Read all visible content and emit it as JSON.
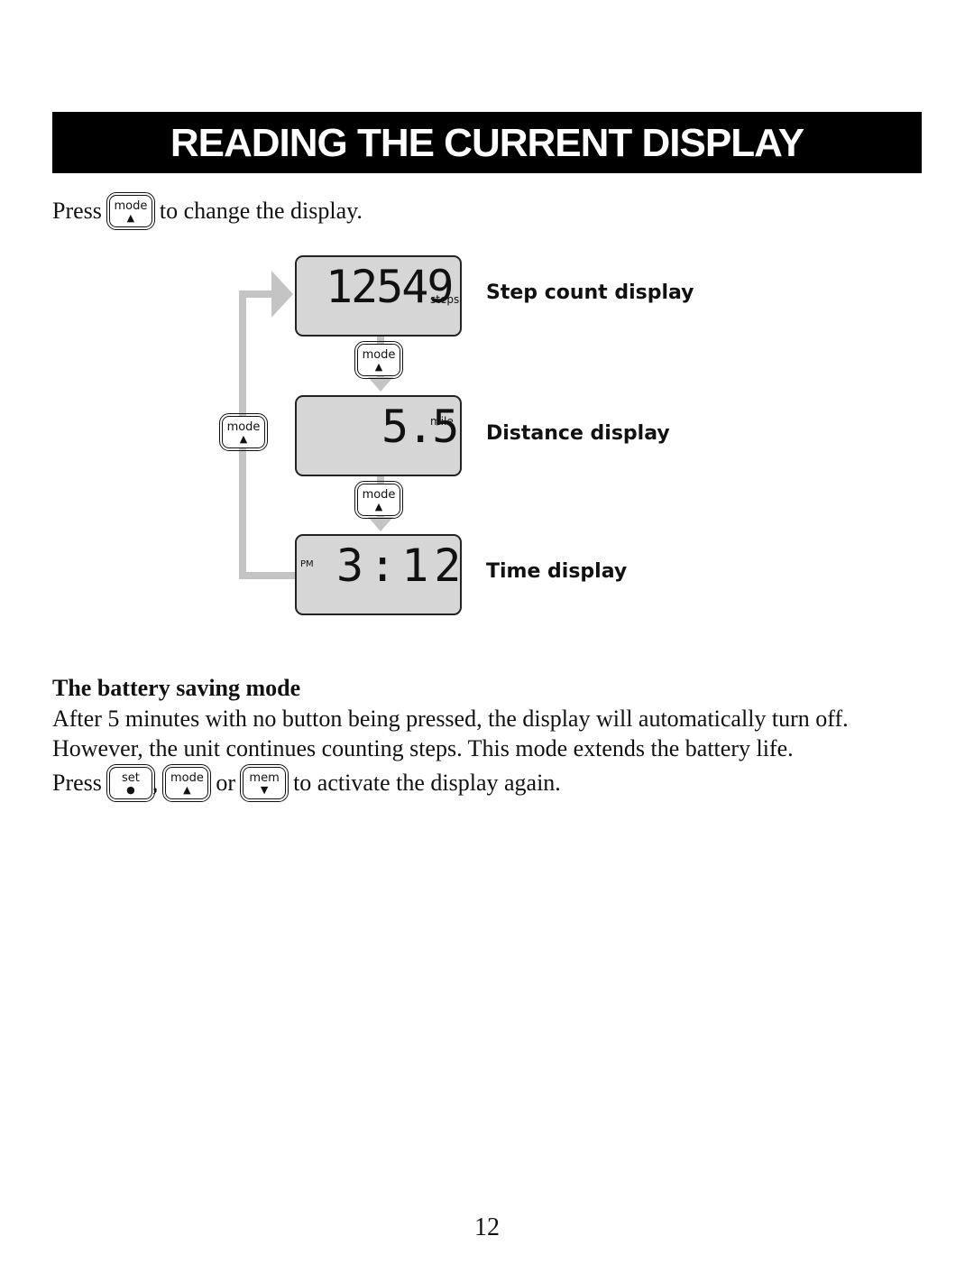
{
  "title": "READING THE CURRENT DISPLAY",
  "intro": {
    "before": "Press",
    "after": "to change the display."
  },
  "keys": {
    "mode": {
      "label": "mode",
      "glyph": "▲"
    },
    "set": {
      "label": "set",
      "glyph": "●"
    },
    "mem": {
      "label": "mem",
      "glyph": "▼"
    }
  },
  "displays": [
    {
      "value": "12549",
      "unit": "steps",
      "label": "Step count display"
    },
    {
      "value": "5.5",
      "unit": "mile",
      "label": "Distance display"
    },
    {
      "value": "3:12",
      "unit": "PM",
      "label": "Time display"
    }
  ],
  "battery": {
    "heading": "The battery saving mode",
    "line1": "After 5 minutes with no button being pressed, the display will automatically turn off.",
    "line2": "However, the unit continues counting steps. This mode extends the battery life.",
    "press": "Press",
    "comma": ",",
    "or": "or",
    "after": "to activate the display again."
  },
  "page_number": "12",
  "colors": {
    "connector": "#c4c4c4",
    "lcd": "#d6d6d6",
    "banner": "#000000"
  }
}
